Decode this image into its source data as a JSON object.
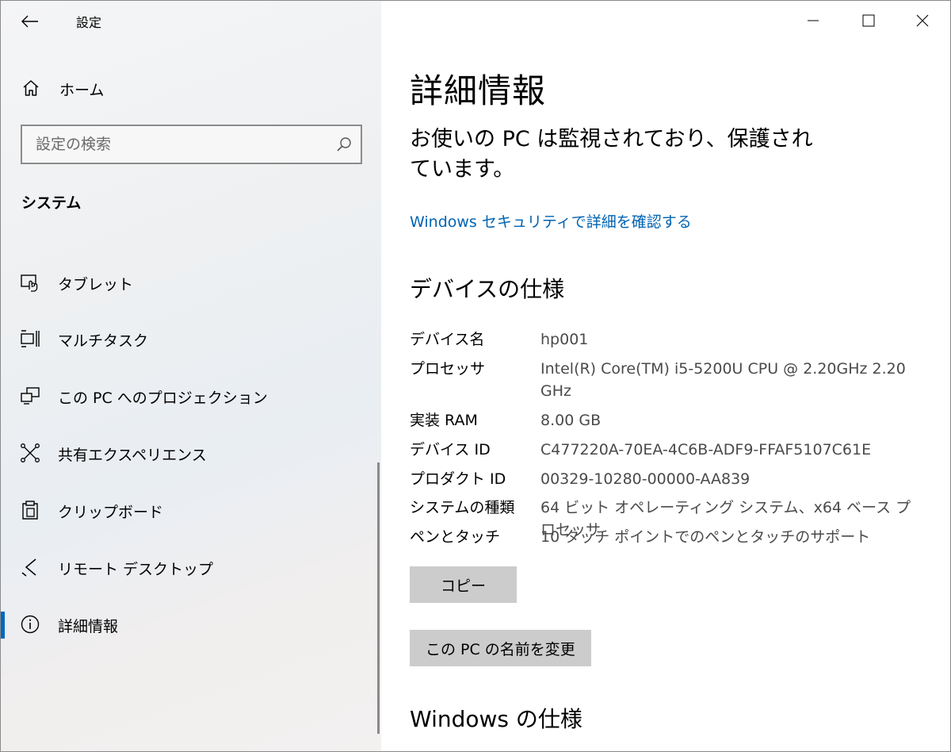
{
  "window": {
    "title": "設定",
    "controls": {
      "minimize": "minimize-icon",
      "maximize": "maximize-icon",
      "close": "close-icon"
    }
  },
  "sidebar": {
    "home_label": "ホーム",
    "search_placeholder": "設定の検索",
    "section_title": "システム",
    "items": [
      {
        "label": "タブレット",
        "icon": "tablet-icon"
      },
      {
        "label": "マルチタスク",
        "icon": "multitasking-icon"
      },
      {
        "label": "この PC へのプロジェクション",
        "icon": "projection-icon"
      },
      {
        "label": "共有エクスペリエンス",
        "icon": "shared-experiences-icon"
      },
      {
        "label": "クリップボード",
        "icon": "clipboard-icon"
      },
      {
        "label": "リモート デスクトップ",
        "icon": "remote-desktop-icon"
      },
      {
        "label": "詳細情報",
        "icon": "info-icon",
        "active": true
      }
    ],
    "accent_color": "#0067c0"
  },
  "main": {
    "title": "詳細情報",
    "status_text": "お使いの PC は監視されており、保護されています。",
    "security_link": "Windows セキュリティで詳細を確認する",
    "device_spec_heading": "デバイスの仕様",
    "specs": [
      {
        "key": "デバイス名",
        "value": "hp001"
      },
      {
        "key": "プロセッサ",
        "value": "Intel(R) Core(TM) i5-5200U CPU @ 2.20GHz   2.20 GHz"
      },
      {
        "key": "実装 RAM",
        "value": "8.00 GB"
      },
      {
        "key": "デバイス ID",
        "value": "C477220A-70EA-4C6B-ADF9-FFAF5107C61E"
      },
      {
        "key": "プロダクト ID",
        "value": "00329-10280-00000-AA839"
      },
      {
        "key": "システムの種類",
        "value": "64 ビット オペレーティング システム、x64 ベース プロセッサ"
      },
      {
        "key": "ペンとタッチ",
        "value": "10 タッチ ポイントでのペンとタッチのサポート"
      }
    ],
    "copy_button": "コピー",
    "rename_button": "この PC の名前を変更",
    "windows_spec_heading": "Windows の仕様",
    "link_color": "#0063b1"
  }
}
